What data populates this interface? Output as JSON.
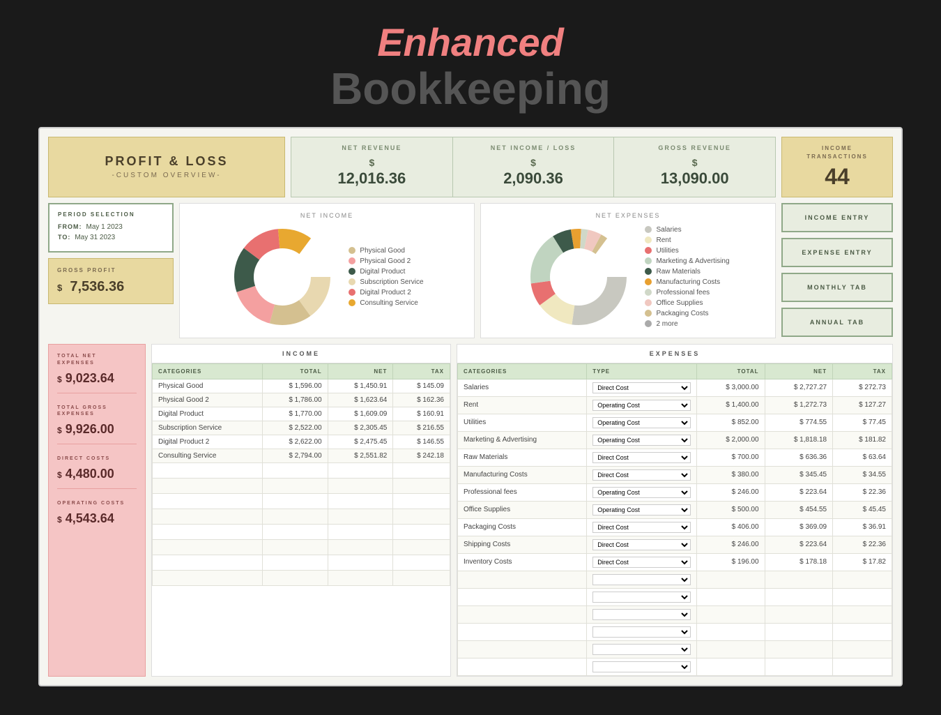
{
  "header": {
    "enhanced": "Enhanced",
    "bookkeeping": "Bookkeeping"
  },
  "top_row": {
    "profit_loss_title": "PROFIT & LOSS",
    "profit_loss_sub": "-CUSTOM OVERVIEW-",
    "net_revenue_label": "NET REVENUE",
    "net_revenue_value": "12,016.36",
    "net_income_label": "NET INCOME / LOSS",
    "net_income_value": "2,090.36",
    "gross_revenue_label": "GROSS REVENUE",
    "gross_revenue_value": "13,090.00",
    "income_trans_label": "INCOME\nTRANSACTIONS",
    "income_trans_value": "44",
    "currency_symbol": "$"
  },
  "period": {
    "title": "PERIOD SELECTION",
    "from_label": "FROM:",
    "from_value": "May 1 2023",
    "to_label": "TO:",
    "to_value": "May 31 2023"
  },
  "gross_profit": {
    "label": "GROSS PROFIT",
    "currency": "$",
    "value": "7,536.36"
  },
  "net_income_chart": {
    "title": "NET INCOME",
    "legend": [
      {
        "label": "Physical Good",
        "color": "#d4c090"
      },
      {
        "label": "Physical Good 2",
        "color": "#f4a0a0"
      },
      {
        "label": "Digital Product",
        "color": "#3d5a4a"
      },
      {
        "label": "Subscription Service",
        "color": "#e8d8b0"
      },
      {
        "label": "Digital Product 2",
        "color": "#e87070"
      },
      {
        "label": "Consulting Service",
        "color": "#e8a830"
      }
    ],
    "segments": [
      {
        "value": 1596,
        "color": "#d4c090"
      },
      {
        "value": 1786,
        "color": "#f4a0a0"
      },
      {
        "value": 1770,
        "color": "#3d5a4a"
      },
      {
        "value": 2522,
        "color": "#e8d8b0"
      },
      {
        "value": 2622,
        "color": "#e87070"
      },
      {
        "value": 2794,
        "color": "#e8a830"
      }
    ]
  },
  "net_expenses_chart": {
    "title": "NET EXPENSES",
    "legend": [
      {
        "label": "Salaries",
        "color": "#c8c8c0"
      },
      {
        "label": "Rent",
        "color": "#f0e8c0"
      },
      {
        "label": "Utilities",
        "color": "#e87070"
      },
      {
        "label": "Marketing & Advertising",
        "color": "#c0d4c0"
      },
      {
        "label": "Raw Materials",
        "color": "#3d5a4a"
      },
      {
        "label": "Manufacturing Costs",
        "color": "#e8a030"
      },
      {
        "label": "Professional fees",
        "color": "#d0d8c8"
      },
      {
        "label": "Office Supplies",
        "color": "#f0c8c0"
      },
      {
        "label": "Packaging Costs",
        "color": "#d4c090"
      },
      {
        "label": "2 more",
        "color": "#aaa"
      }
    ],
    "segments": [
      {
        "value": 3000,
        "color": "#c8c8c0"
      },
      {
        "value": 1400,
        "color": "#f0e8c0"
      },
      {
        "value": 852,
        "color": "#e87070"
      },
      {
        "value": 2000,
        "color": "#c0d4c0"
      },
      {
        "value": 700,
        "color": "#3d5a4a"
      },
      {
        "value": 380,
        "color": "#e8a030"
      },
      {
        "value": 246,
        "color": "#d0d8c8"
      },
      {
        "value": 500,
        "color": "#f0c8c0"
      },
      {
        "value": 406,
        "color": "#d4c090"
      }
    ]
  },
  "buttons": [
    {
      "label": "INCOME ENTRY"
    },
    {
      "label": "EXPENSE ENTRY"
    },
    {
      "label": "MONTHLY TAB"
    },
    {
      "label": "ANNUAL TAB"
    }
  ],
  "totals": [
    {
      "label": "TOTAL NET\nEXPENSES",
      "currency": "$",
      "value": "9,023.64"
    },
    {
      "label": "TOTAL GROSS\nEXPENSES",
      "currency": "$",
      "value": "9,926.00"
    },
    {
      "label": "DIRECT COSTS",
      "currency": "$",
      "value": "4,480.00"
    },
    {
      "label": "OPERATING\nCOSTS",
      "currency": "$",
      "value": "4,543.64"
    }
  ],
  "income_table": {
    "section_title": "INCOME",
    "headers": [
      "CATEGORIES",
      "TOTAL",
      "NET",
      "TAX"
    ],
    "rows": [
      [
        "Physical Good",
        "$ 1,596.00",
        "$ 1,450.91",
        "$ 145.09"
      ],
      [
        "Physical Good 2",
        "$ 1,786.00",
        "$ 1,623.64",
        "$ 162.36"
      ],
      [
        "Digital Product",
        "$ 1,770.00",
        "$ 1,609.09",
        "$ 160.91"
      ],
      [
        "Subscription Service",
        "$ 2,522.00",
        "$ 2,305.45",
        "$ 216.55"
      ],
      [
        "Digital Product 2",
        "$ 2,622.00",
        "$ 2,475.45",
        "$ 146.55"
      ],
      [
        "Consulting Service",
        "$ 2,794.00",
        "$ 2,551.82",
        "$ 242.18"
      ]
    ]
  },
  "expenses_table": {
    "section_title": "EXPENSES",
    "headers": [
      "CATEGORIES",
      "TYPE",
      "TOTAL",
      "NET",
      "TAX"
    ],
    "rows": [
      [
        "Salaries",
        "Direct Cost",
        "$ 3,000.00",
        "$ 2,727.27",
        "$ 272.73"
      ],
      [
        "Rent",
        "Operating Cost",
        "$ 1,400.00",
        "$ 1,272.73",
        "$ 127.27"
      ],
      [
        "Utilities",
        "Operating Cost",
        "$ 852.00",
        "$ 774.55",
        "$ 77.45"
      ],
      [
        "Marketing & Advertising",
        "Operating Cost",
        "$ 2,000.00",
        "$ 1,818.18",
        "$ 181.82"
      ],
      [
        "Raw Materials",
        "Direct Cost",
        "$ 700.00",
        "$ 636.36",
        "$ 63.64"
      ],
      [
        "Manufacturing Costs",
        "Direct Cost",
        "$ 380.00",
        "$ 345.45",
        "$ 34.55"
      ],
      [
        "Professional fees",
        "Operating Cost",
        "$ 246.00",
        "$ 223.64",
        "$ 22.36"
      ],
      [
        "Office Supplies",
        "Operating Cost",
        "$ 500.00",
        "$ 454.55",
        "$ 45.45"
      ],
      [
        "Packaging Costs",
        "Direct Cost",
        "$ 406.00",
        "$ 369.09",
        "$ 36.91"
      ],
      [
        "Shipping Costs",
        "Direct Cost",
        "$ 246.00",
        "$ 223.64",
        "$ 22.36"
      ],
      [
        "Inventory Costs",
        "Direct Cost",
        "$ 196.00",
        "$ 178.18",
        "$ 17.82"
      ]
    ],
    "type_options": [
      "Direct Cost",
      "Operating Cost"
    ]
  }
}
